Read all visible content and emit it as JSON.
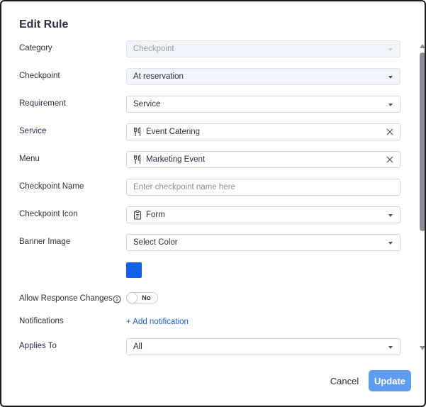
{
  "dialog": {
    "title": "Edit Rule"
  },
  "fields": {
    "category": {
      "label": "Category",
      "value": "Checkpoint"
    },
    "checkpoint": {
      "label": "Checkpoint",
      "value": "At reservation"
    },
    "requirement": {
      "label": "Requirement",
      "value": "Service"
    },
    "service": {
      "label": "Service",
      "value": "Event Catering",
      "icon": "utensils-icon"
    },
    "menu": {
      "label": "Menu",
      "value": "Marketing Event",
      "icon": "utensils-icon"
    },
    "checkpoint_name": {
      "label": "Checkpoint Name",
      "value": "",
      "placeholder": "Enter checkpoint name here"
    },
    "checkpoint_icon": {
      "label": "Checkpoint Icon",
      "value": "Form",
      "icon": "clipboard-icon"
    },
    "banner_image": {
      "label": "Banner Image",
      "value": "Select Color",
      "swatch_color": "#1160e8"
    },
    "allow_response_changes": {
      "label": "Allow Response Changes",
      "toggle_text": "No",
      "enabled": false
    },
    "notifications": {
      "label": "Notifications",
      "add_link": "+ Add notification"
    },
    "applies_to": {
      "label": "Applies To",
      "value": "All"
    }
  },
  "footer": {
    "cancel_label": "Cancel",
    "update_label": "Update"
  },
  "colors": {
    "primary_button": "#5f9bef",
    "link": "#1a5fc8"
  }
}
